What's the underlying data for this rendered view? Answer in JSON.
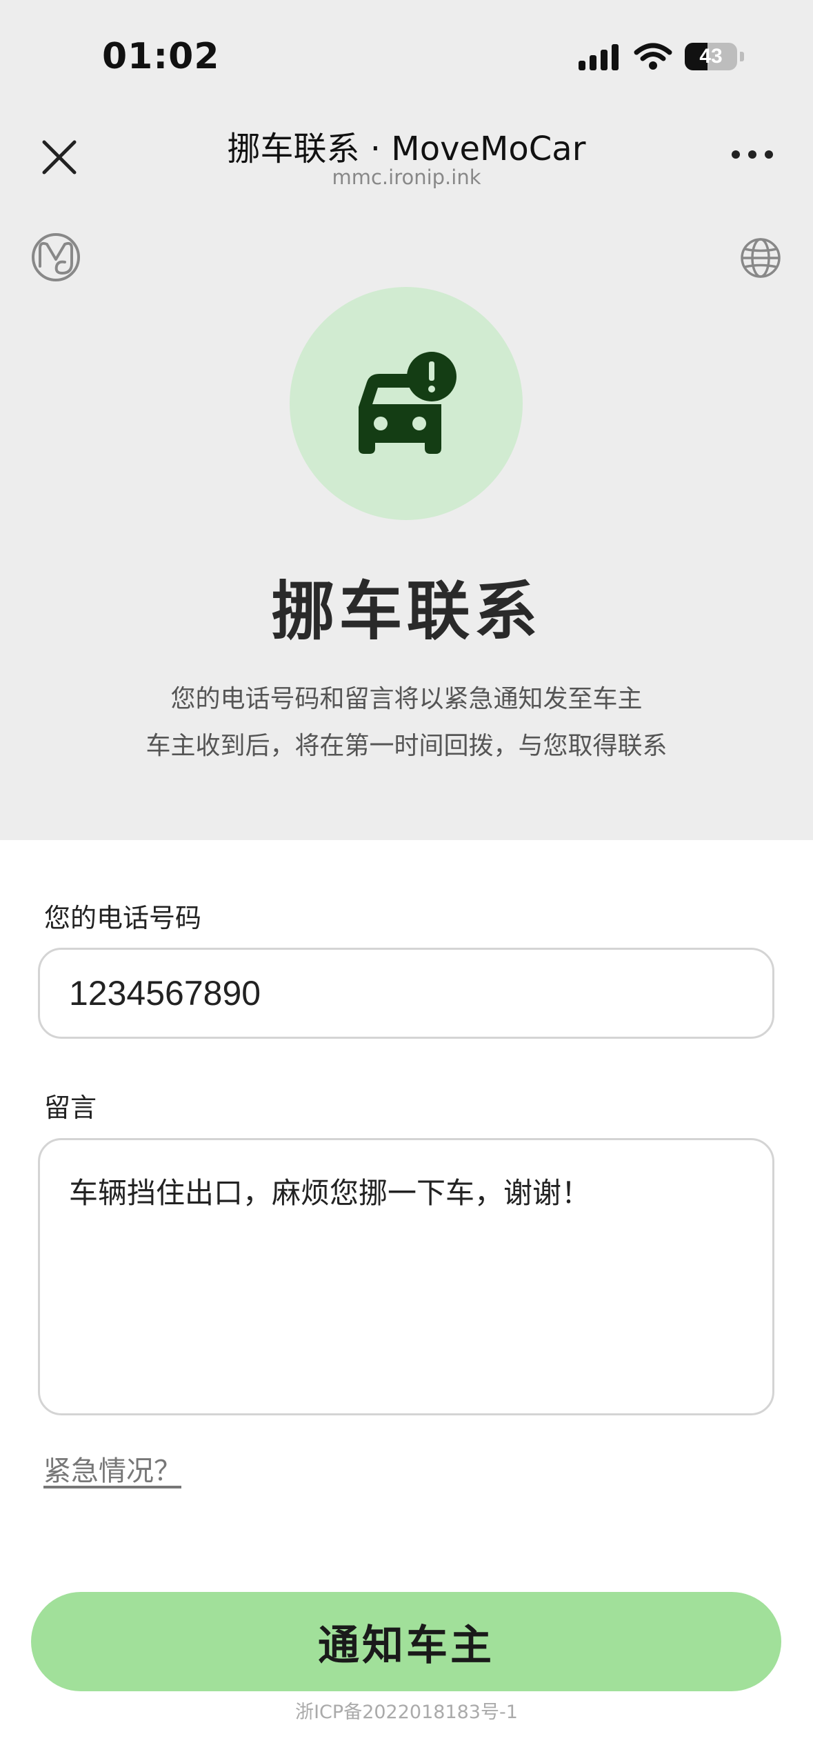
{
  "status_bar": {
    "time": "01:02",
    "battery": 43,
    "battery_label": "43"
  },
  "nav": {
    "title": "挪车联系 · MoveMoCar",
    "url": "mmc.ironip.ink",
    "close_icon": "close-icon",
    "more_icon": "more-icon"
  },
  "icons": {
    "logo": "logo-icon",
    "language": "globe-icon",
    "hero": "car-alert-icon"
  },
  "hero": {
    "title": "挪车联系",
    "desc_line1": "您的电话号码和留言将以紧急通知发至车主",
    "desc_line2": "车主收到后，将在第一时间回拨，与您取得联系"
  },
  "form": {
    "phone_label": "您的电话号码",
    "phone_value": "1234567890",
    "message_label": "留言",
    "message_value": "车辆挡住出口，麻烦您挪一下车，谢谢！",
    "emergency_link": "紧急情况？"
  },
  "actions": {
    "notify_label": "通知车主"
  },
  "footer": {
    "icp": "浙ICP备2022018183号-1"
  },
  "colors": {
    "background_top": "#ededed",
    "hero_circle": "#d1ebd1",
    "icon_dark_green": "#143d14",
    "button_green": "#a1e09a"
  }
}
